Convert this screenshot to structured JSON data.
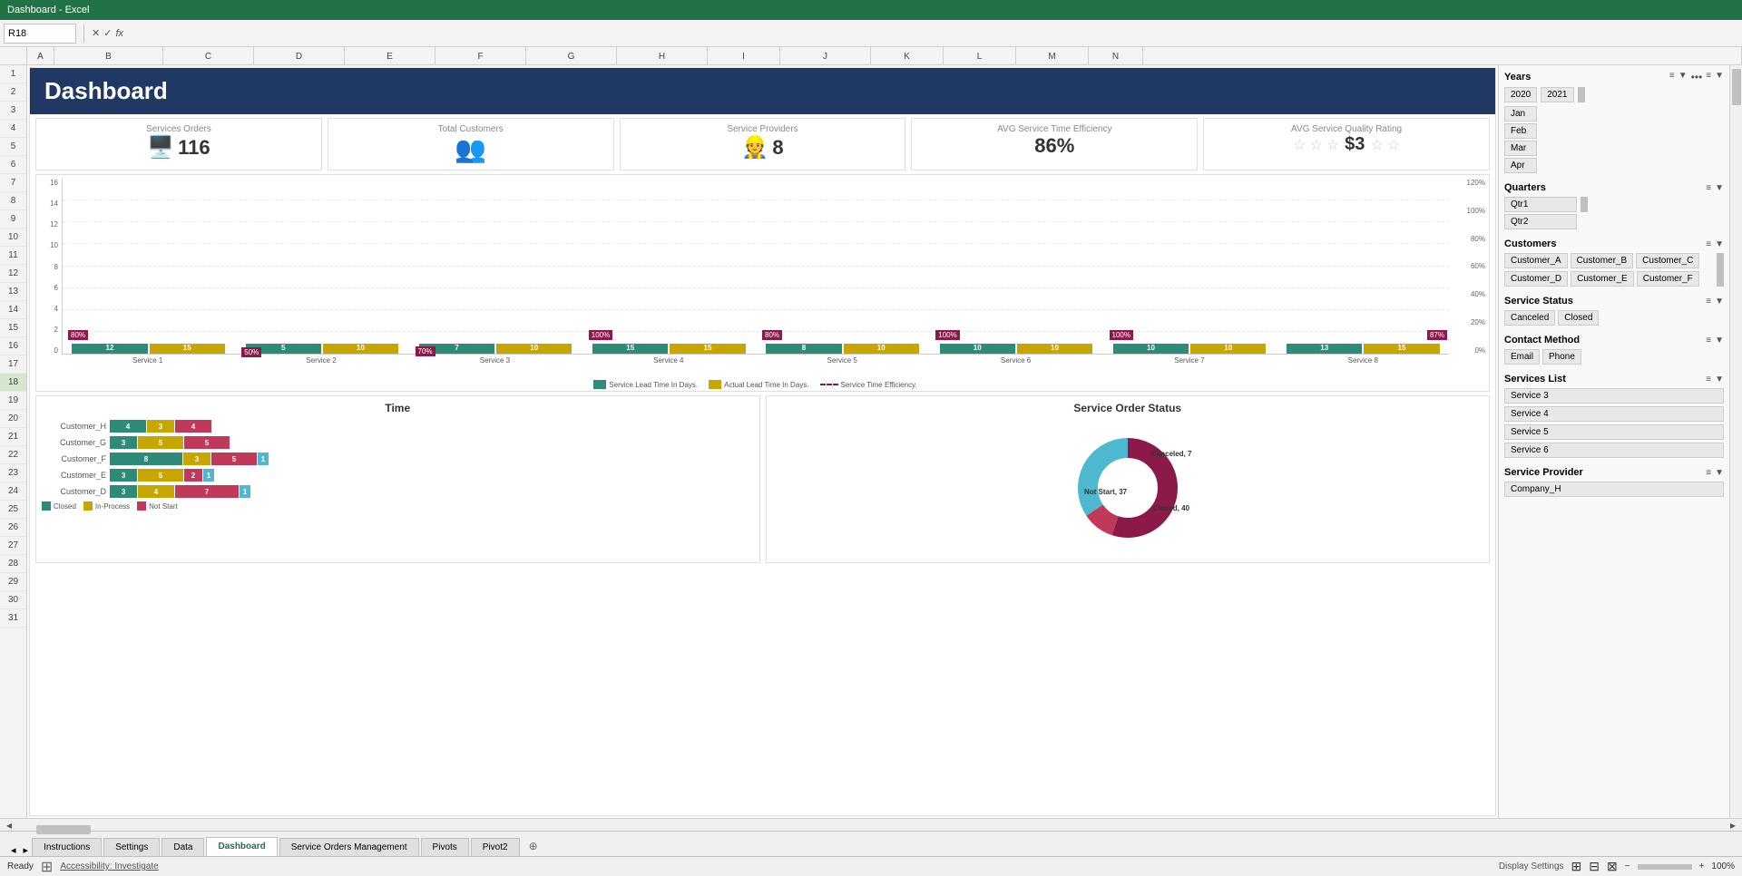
{
  "title": "Dashboard - Excel",
  "formula_bar": {
    "cell_ref": "R18",
    "formula": ""
  },
  "columns": [
    "A",
    "B",
    "C",
    "D",
    "E",
    "F",
    "G",
    "H",
    "I",
    "J",
    "K",
    "L",
    "M",
    "N"
  ],
  "row_numbers": [
    "1",
    "2",
    "3",
    "4",
    "5",
    "6",
    "7",
    "8",
    "9",
    "10",
    "11",
    "12",
    "13",
    "14",
    "15",
    "16",
    "17",
    "18",
    "19",
    "20",
    "21",
    "22",
    "23",
    "24",
    "25",
    "26",
    "27",
    "28",
    "29",
    "30",
    "31"
  ],
  "dashboard": {
    "title": "Dashboard",
    "kpi": [
      {
        "label": "Services Orders",
        "value": "116",
        "icon": "🖥️"
      },
      {
        "label": "Total Customers",
        "value": "",
        "icon": "👥"
      },
      {
        "label": "Service Providers",
        "value": "8",
        "icon": "👷"
      },
      {
        "label": "AVG Service Time Efficiency",
        "value": "86%",
        "icon": ""
      },
      {
        "label": "AVG Service Quality Rating",
        "value": "3",
        "icon": "⭐"
      }
    ],
    "bar_chart": {
      "services": [
        "Service 1",
        "Service 2",
        "Service 3",
        "Service 4",
        "Service 5",
        "Service 6",
        "Service 7",
        "Service 8"
      ],
      "lead_times": [
        12,
        5,
        7,
        15,
        8,
        10,
        10,
        13
      ],
      "actual_times": [
        15,
        10,
        10,
        15,
        10,
        10,
        10,
        15
      ],
      "efficiencies": [
        "80%",
        "50%",
        "70%",
        "100%",
        "80%",
        "100%",
        "100%",
        "87%"
      ],
      "y_labels": [
        "16",
        "14",
        "12",
        "10",
        "8",
        "6",
        "4",
        "2",
        "0"
      ],
      "y_right_labels": [
        "120%",
        "100%",
        "80%",
        "60%",
        "40%",
        "20%",
        "0%"
      ],
      "legend": [
        "Service Lead Time In Days.",
        "Actual Lead Time In Days.",
        "Service Time Efficiency."
      ]
    },
    "time_chart": {
      "title": "Time",
      "customers": [
        {
          "name": "Customer_H",
          "closed": 4,
          "in_process": 3,
          "not_start": 4,
          "other": 0
        },
        {
          "name": "Customer_G",
          "closed": 3,
          "in_process": 5,
          "not_start": 5,
          "other": 0
        },
        {
          "name": "Customer_F",
          "closed": 8,
          "in_process": 3,
          "not_start": 5,
          "other": 1
        },
        {
          "name": "Customer_E",
          "closed": 3,
          "in_process": 5,
          "not_start": 2,
          "other": 1
        },
        {
          "name": "Customer_D",
          "closed": 3,
          "in_process": 4,
          "not_start": 7,
          "other": 1
        }
      ],
      "legend": [
        "Closed",
        "In-Process",
        "Not Start"
      ]
    },
    "status_chart": {
      "title": "Service Order Status",
      "segments": [
        {
          "label": "Canceled",
          "value": 7,
          "color": "#c0395a"
        },
        {
          "label": "Closed",
          "value": 40,
          "color": "#4db8d0"
        },
        {
          "label": "Not Start",
          "value": 37,
          "color": "#8b1a4a"
        }
      ]
    }
  },
  "filters": {
    "years": {
      "title": "Years",
      "items": [
        "2020",
        "2021"
      ],
      "months": [
        "Jan",
        "Feb",
        "Mar",
        "Apr"
      ]
    },
    "quarters": {
      "title": "Quarters",
      "items": [
        "Qtr1",
        "Qtr2"
      ]
    },
    "customers": {
      "title": "Customers",
      "items": [
        "Customer_A",
        "Customer_B",
        "Customer_C",
        "Customer_D",
        "Customer_E",
        "Customer_F"
      ]
    },
    "service_status": {
      "title": "Service Status",
      "items": [
        "Canceled",
        "Closed"
      ]
    },
    "contact_method": {
      "title": "Contact Method",
      "items": [
        "Email",
        "Phone"
      ]
    },
    "services_list": {
      "title": "Services List",
      "items": [
        "Service 3",
        "Service 4",
        "Service 5",
        "Service 6"
      ]
    },
    "service_provider": {
      "title": "Service Provider",
      "items": [
        "Company_H"
      ]
    }
  },
  "tabs": [
    "Instructions",
    "Settings",
    "Data",
    "Dashboard",
    "Service Orders Management",
    "Pivots",
    "Pivot2"
  ],
  "active_tab": "Dashboard",
  "status_bar": {
    "ready": "Ready",
    "accessibility": "Accessibility: Investigate",
    "display": "Display Settings",
    "zoom": "100%"
  }
}
